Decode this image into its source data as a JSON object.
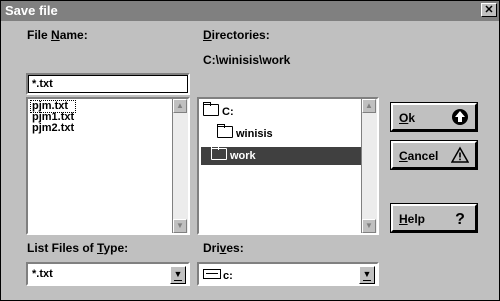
{
  "window": {
    "title": "Save file",
    "close_glyph": "✕"
  },
  "file_name": {
    "label_prefix": "File ",
    "label_underlined": "N",
    "label_suffix": "ame:",
    "value": "*.txt"
  },
  "files": [
    {
      "name": "pjm.txt",
      "selected": true
    },
    {
      "name": "pjm1.txt",
      "selected": false
    },
    {
      "name": "pjm2.txt",
      "selected": false
    }
  ],
  "list_type": {
    "label_prefix": "List Files of ",
    "label_underlined": "T",
    "label_suffix": "ype:",
    "value": "*.txt"
  },
  "directories": {
    "label_underlined": "D",
    "label_suffix": "irectories:",
    "current_path": "C:\\winisis\\work",
    "items": [
      {
        "name": "C:",
        "icon": "open-folder-icon",
        "selected": false
      },
      {
        "name": "winisis",
        "icon": "open-folder-icon",
        "selected": false
      },
      {
        "name": "work",
        "icon": "open-folder-icon",
        "selected": true
      }
    ]
  },
  "drives": {
    "label_prefix": "Dri",
    "label_underlined": "v",
    "label_suffix": "es:",
    "value": "c:",
    "icon": "drive-icon"
  },
  "buttons": {
    "ok": {
      "label_underlined": "O",
      "label_suffix": "k",
      "icon": "up-arrow-circle-icon"
    },
    "cancel": {
      "label_underlined": "C",
      "label_suffix": "ancel",
      "icon": "warning-icon"
    },
    "help": {
      "label_underlined": "H",
      "label_suffix": "elp",
      "icon": "question-icon"
    }
  }
}
